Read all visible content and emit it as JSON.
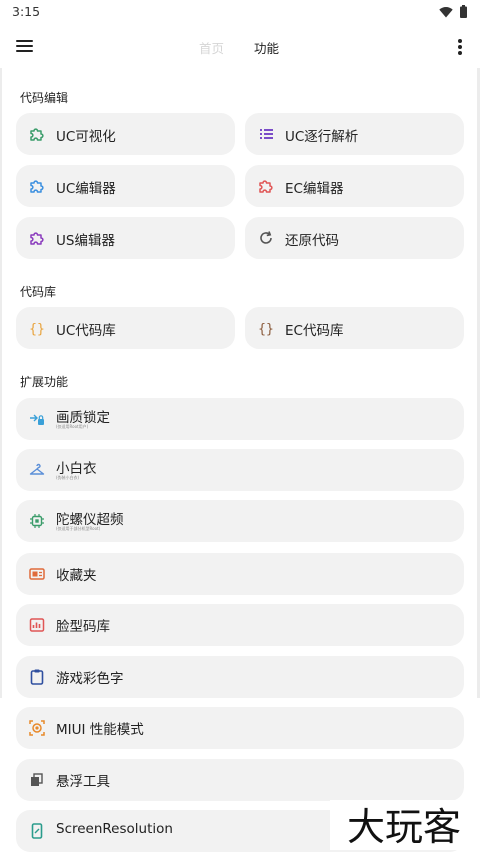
{
  "status_bar": {
    "time": "3:15"
  },
  "header": {
    "tab_home": "首页",
    "tab_function": "功能"
  },
  "sections": {
    "code_edit": {
      "title": "代码编辑",
      "items": [
        {
          "label": "UC可视化",
          "icon": "puzzle-icon",
          "color": "#3a9c6a"
        },
        {
          "label": "UC逐行解析",
          "icon": "list-icon",
          "color": "#7a4cc8"
        },
        {
          "label": "UC编辑器",
          "icon": "puzzle-icon",
          "color": "#3b8fe0"
        },
        {
          "label": "EC编辑器",
          "icon": "puzzle-icon",
          "color": "#e05555"
        },
        {
          "label": "US编辑器",
          "icon": "puzzle-icon",
          "color": "#8a3bbd"
        },
        {
          "label": "还原代码",
          "icon": "refresh-icon",
          "color": "#555555"
        }
      ]
    },
    "code_lib": {
      "title": "代码库",
      "items": [
        {
          "label": "UC代码库",
          "icon": "braces-icon",
          "color": "#e8a23a"
        },
        {
          "label": "EC代码库",
          "icon": "braces-icon",
          "color": "#8a5a3a"
        }
      ]
    },
    "extensions": {
      "title": "扩展功能",
      "items": [
        {
          "label": "画质锁定",
          "sub": "(仅适用Root用户)",
          "icon": "lock-link-icon",
          "color": "#3aa0d8"
        },
        {
          "label": "小白衣",
          "sub": "(伪装小白衣)",
          "icon": "hanger-icon",
          "color": "#5b8fd8"
        },
        {
          "label": "陀螺仪超频",
          "sub": "(仅适用于部分机型Root)",
          "icon": "chip-icon",
          "color": "#3a9c6a"
        },
        {
          "label": "收藏夹",
          "icon": "slides-icon",
          "color": "#e06a3a"
        },
        {
          "label": "脸型码库",
          "icon": "chart-icon",
          "color": "#e05555"
        },
        {
          "label": "游戏彩色字",
          "icon": "clipboard-icon",
          "color": "#2f4f9f"
        },
        {
          "label": "MIUI 性能模式",
          "icon": "target-icon",
          "color": "#e8892a"
        },
        {
          "label": "悬浮工具",
          "icon": "layers-icon",
          "color": "#555555"
        },
        {
          "label": "ScreenResolution",
          "icon": "phone-icon",
          "color": "#2a9c8c"
        }
      ]
    }
  },
  "watermark": {
    "text": "大玩客"
  }
}
